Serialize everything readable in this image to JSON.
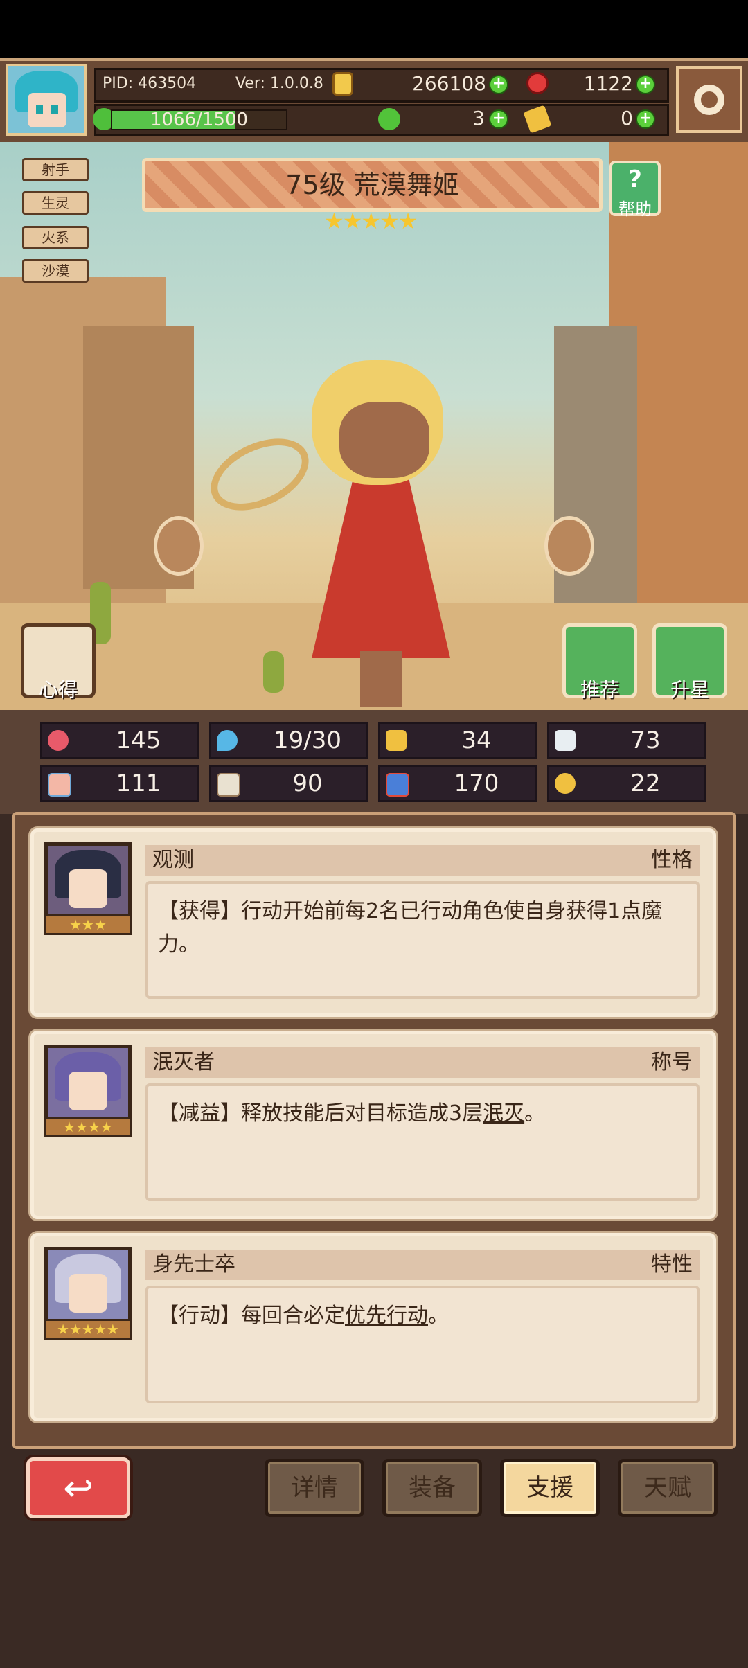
{
  "header": {
    "pid_label": "PID: 463504",
    "version_label": "Ver: 1.0.0.8",
    "gold": "266108",
    "gems": "1122",
    "exp": "1066/1500",
    "exp_fraction": 0.711,
    "clover": "3",
    "hammer": "0"
  },
  "tags": [
    "射手",
    "生灵",
    "火系",
    "沙漠"
  ],
  "hero": {
    "title": "75级 荒漠舞姬",
    "stars": "★★★★★",
    "star_count": 5
  },
  "buttons": {
    "help": "帮助",
    "help_icon": "?",
    "xinde": "心得",
    "tuijian": "推荐",
    "shengxing": "升星"
  },
  "stats": {
    "hp": "145",
    "mana": "19/30",
    "defense": "34",
    "speed": "73",
    "attack": "111",
    "magic": "90",
    "crit": "170",
    "lucky": "22"
  },
  "cards": [
    {
      "name": "观测",
      "type": "性格",
      "stars": "★★★",
      "desc": "【获得】行动开始前每2名已行动角色使自身获得1点魔力。",
      "desc_prefix": "",
      "desc_link": "",
      "desc_suffix": ""
    },
    {
      "name": "泯灭者",
      "type": "称号",
      "stars": "★★★★",
      "desc_prefix": "【减益】释放技能后对目标造成3层",
      "desc_link": "泯灭",
      "desc_suffix": "。"
    },
    {
      "name": "身先士卒",
      "type": "特性",
      "stars": "★★★★★",
      "desc_prefix": "【行动】每回合必定",
      "desc_link": "优先行动",
      "desc_suffix": "。"
    }
  ],
  "bottom": {
    "back_icon": "↩",
    "tabs": [
      "详情",
      "装备",
      "支援",
      "天赋"
    ],
    "active_tab": "支援"
  },
  "colors": {
    "accent_green": "#58c34a",
    "panel_brown": "#6a4a36",
    "card_bg": "#efe1cb"
  }
}
